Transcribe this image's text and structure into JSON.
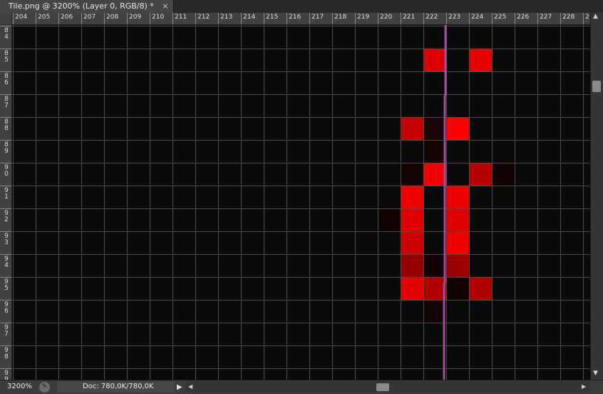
{
  "tab": {
    "title": "Tile.png @ 3200% (Layer 0, RGB/8) *",
    "close_glyph": "×"
  },
  "ruler": {
    "h_labels": [
      "204",
      "205",
      "206",
      "207",
      "208",
      "209",
      "210",
      "211",
      "212",
      "213",
      "214",
      "215",
      "216",
      "217",
      "218",
      "219",
      "220",
      "221",
      "222",
      "223",
      "224",
      "225",
      "226",
      "227",
      "228",
      "2"
    ],
    "v_labels": [
      "84",
      "85",
      "86",
      "87",
      "88",
      "89",
      "90",
      "91",
      "92",
      "93",
      "94",
      "95",
      "96",
      "97",
      "98",
      "99"
    ]
  },
  "canvas": {
    "background": "#0a0a0b",
    "grid_color": "#4a4a4a",
    "guide_color": "#a24ca3",
    "first_visible_column": 204,
    "first_visible_row": 84,
    "guide_column": 223,
    "pixels": [
      {
        "col": 222,
        "row": 85,
        "color": "#dd0000"
      },
      {
        "col": 224,
        "row": 85,
        "color": "#e80000"
      },
      {
        "col": 221,
        "row": 88,
        "color": "#c40000"
      },
      {
        "col": 222,
        "row": 88,
        "color": "#1d0606"
      },
      {
        "col": 223,
        "row": 88,
        "color": "#ff0000"
      },
      {
        "col": 222,
        "row": 89,
        "color": "#150404"
      },
      {
        "col": 221,
        "row": 90,
        "color": "#150404"
      },
      {
        "col": 222,
        "row": 90,
        "color": "#f00000"
      },
      {
        "col": 224,
        "row": 90,
        "color": "#b80000"
      },
      {
        "col": 225,
        "row": 90,
        "color": "#150303"
      },
      {
        "col": 221,
        "row": 91,
        "color": "#f20000"
      },
      {
        "col": 223,
        "row": 91,
        "color": "#ec0000"
      },
      {
        "col": 221,
        "row": 92,
        "color": "#e00000"
      },
      {
        "col": 223,
        "row": 92,
        "color": "#e00000"
      },
      {
        "col": 220,
        "row": 92,
        "color": "#110303"
      },
      {
        "col": 221,
        "row": 93,
        "color": "#cc0000"
      },
      {
        "col": 223,
        "row": 93,
        "color": "#f20000"
      },
      {
        "col": 221,
        "row": 94,
        "color": "#930000"
      },
      {
        "col": 223,
        "row": 94,
        "color": "#9c0000"
      },
      {
        "col": 222,
        "row": 94,
        "color": "#120404"
      },
      {
        "col": 221,
        "row": 95,
        "color": "#e40000"
      },
      {
        "col": 222,
        "row": 95,
        "color": "#b10000"
      },
      {
        "col": 224,
        "row": 95,
        "color": "#b20000"
      },
      {
        "col": 223,
        "row": 95,
        "color": "#130404"
      },
      {
        "col": 222,
        "row": 96,
        "color": "#140404"
      }
    ]
  },
  "status": {
    "zoom": "3200%",
    "doc_info": "Doc: 780,0K/780,0K",
    "menu_arrow": "▶",
    "icon": "status-icon"
  },
  "scroll": {
    "up": "▲",
    "down": "▼",
    "left": "◀",
    "right": "▶"
  }
}
